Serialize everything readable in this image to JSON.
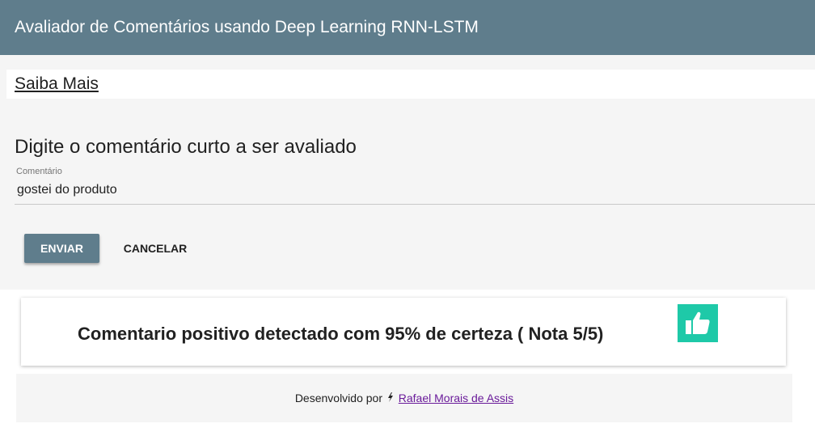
{
  "app": {
    "title": "Avaliador de Comentários usando Deep Learning RNN-LSTM"
  },
  "links": {
    "saiba_mais": "Saiba Mais"
  },
  "form": {
    "heading": "Digite o comentário curto a ser avaliado",
    "field_label": "Comentário",
    "field_value": "gostei do produto",
    "submit_label": "ENVIAR",
    "cancel_label": "CANCELAR"
  },
  "result": {
    "text": "Comentario positivo detectado com 95% de certeza ( Nota 5/5)",
    "icon": "thumbs-up-icon",
    "badge_color": "#1ec9a8"
  },
  "footer": {
    "prefix": "Desenvolvido por",
    "icon": "bolt-icon",
    "author": "Rafael Morais de Assis"
  },
  "colors": {
    "primary": "#5f7d8c",
    "link": "#6a1b9a"
  }
}
